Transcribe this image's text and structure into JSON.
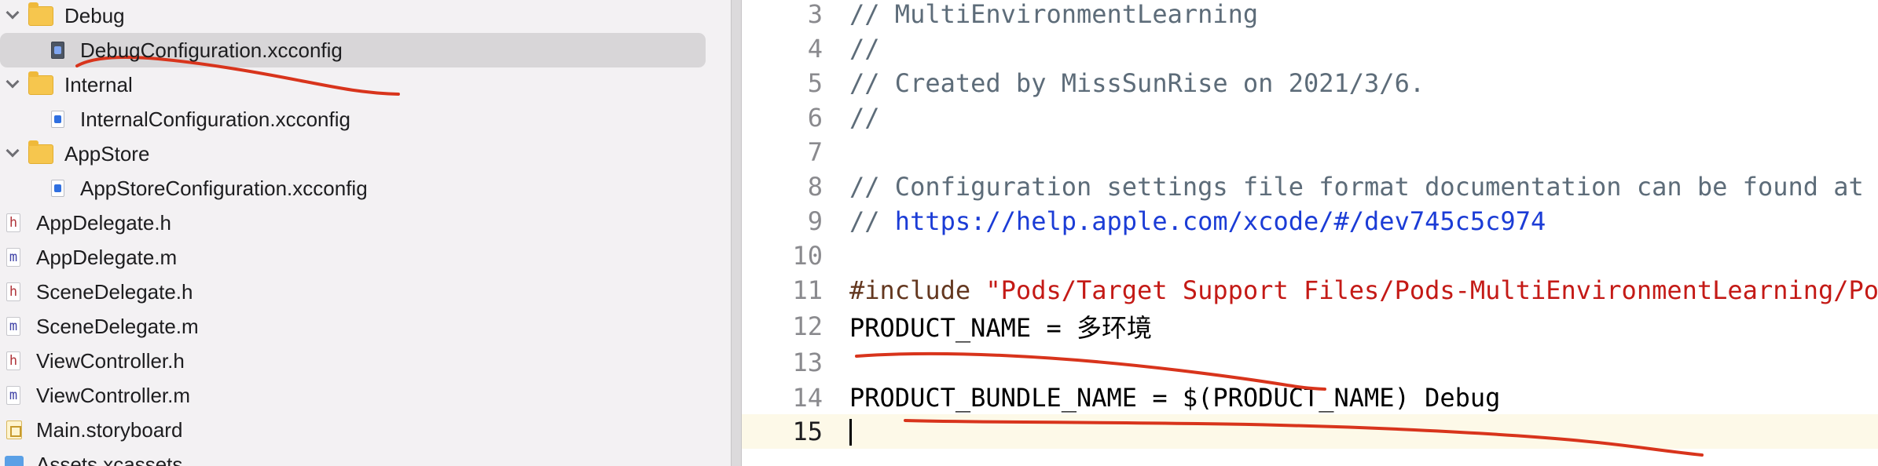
{
  "navigator": {
    "items": [
      {
        "label": "Debug",
        "kind": "folder"
      },
      {
        "label": "DebugConfiguration.xcconfig",
        "kind": "xcconfig"
      },
      {
        "label": "Internal",
        "kind": "folder"
      },
      {
        "label": "InternalConfiguration.xcconfig",
        "kind": "xcconfig"
      },
      {
        "label": "AppStore",
        "kind": "folder"
      },
      {
        "label": "AppStoreConfiguration.xcconfig",
        "kind": "xcconfig"
      },
      {
        "label": "AppDelegate.h",
        "kind": "header",
        "badge": "h"
      },
      {
        "label": "AppDelegate.m",
        "kind": "source",
        "badge": "m"
      },
      {
        "label": "SceneDelegate.h",
        "kind": "header",
        "badge": "h"
      },
      {
        "label": "SceneDelegate.m",
        "kind": "source",
        "badge": "m"
      },
      {
        "label": "ViewController.h",
        "kind": "header",
        "badge": "h"
      },
      {
        "label": "ViewController.m",
        "kind": "source",
        "badge": "m"
      },
      {
        "label": "Main.storyboard",
        "kind": "storyboard"
      },
      {
        "label": "Assets.xcassets",
        "kind": "assets"
      }
    ],
    "selected": "DebugConfiguration.xcconfig"
  },
  "editor": {
    "lines": [
      {
        "n": "3",
        "t": "//  MultiEnvironmentLearning"
      },
      {
        "n": "4",
        "t": "//"
      },
      {
        "n": "5",
        "t": "//  Created by MissSunRise on 2021/3/6."
      },
      {
        "n": "6",
        "t": "//"
      },
      {
        "n": "7",
        "t": ""
      },
      {
        "n": "8",
        "t": "// Configuration settings file format documentation can be found at"
      },
      {
        "n": "9",
        "prefix": "// ",
        "link": "https://help.apple.com/xcode/#/dev745c5c974"
      },
      {
        "n": "10",
        "t": ""
      },
      {
        "n": "11",
        "directive": "#include ",
        "str": "\"Pods/Target Support Files/Pods-MultiEnvironmentLearning/Pods-MultiEnvironmentLearning.debug.xcconfig\""
      },
      {
        "n": "12",
        "t": "PRODUCT_NAME = 多环境"
      },
      {
        "n": "13",
        "t": ""
      },
      {
        "n": "14",
        "t": "PRODUCT_BUNDLE_NAME = $(PRODUCT_NAME) Debug"
      },
      {
        "n": "15",
        "t": ""
      }
    ],
    "current_line": "15"
  },
  "colors": {
    "annotation": "#d8341c",
    "comment": "#5d6c79",
    "link": "#1b3cd6",
    "string": "#c41a16",
    "preprocessor": "#643820"
  }
}
